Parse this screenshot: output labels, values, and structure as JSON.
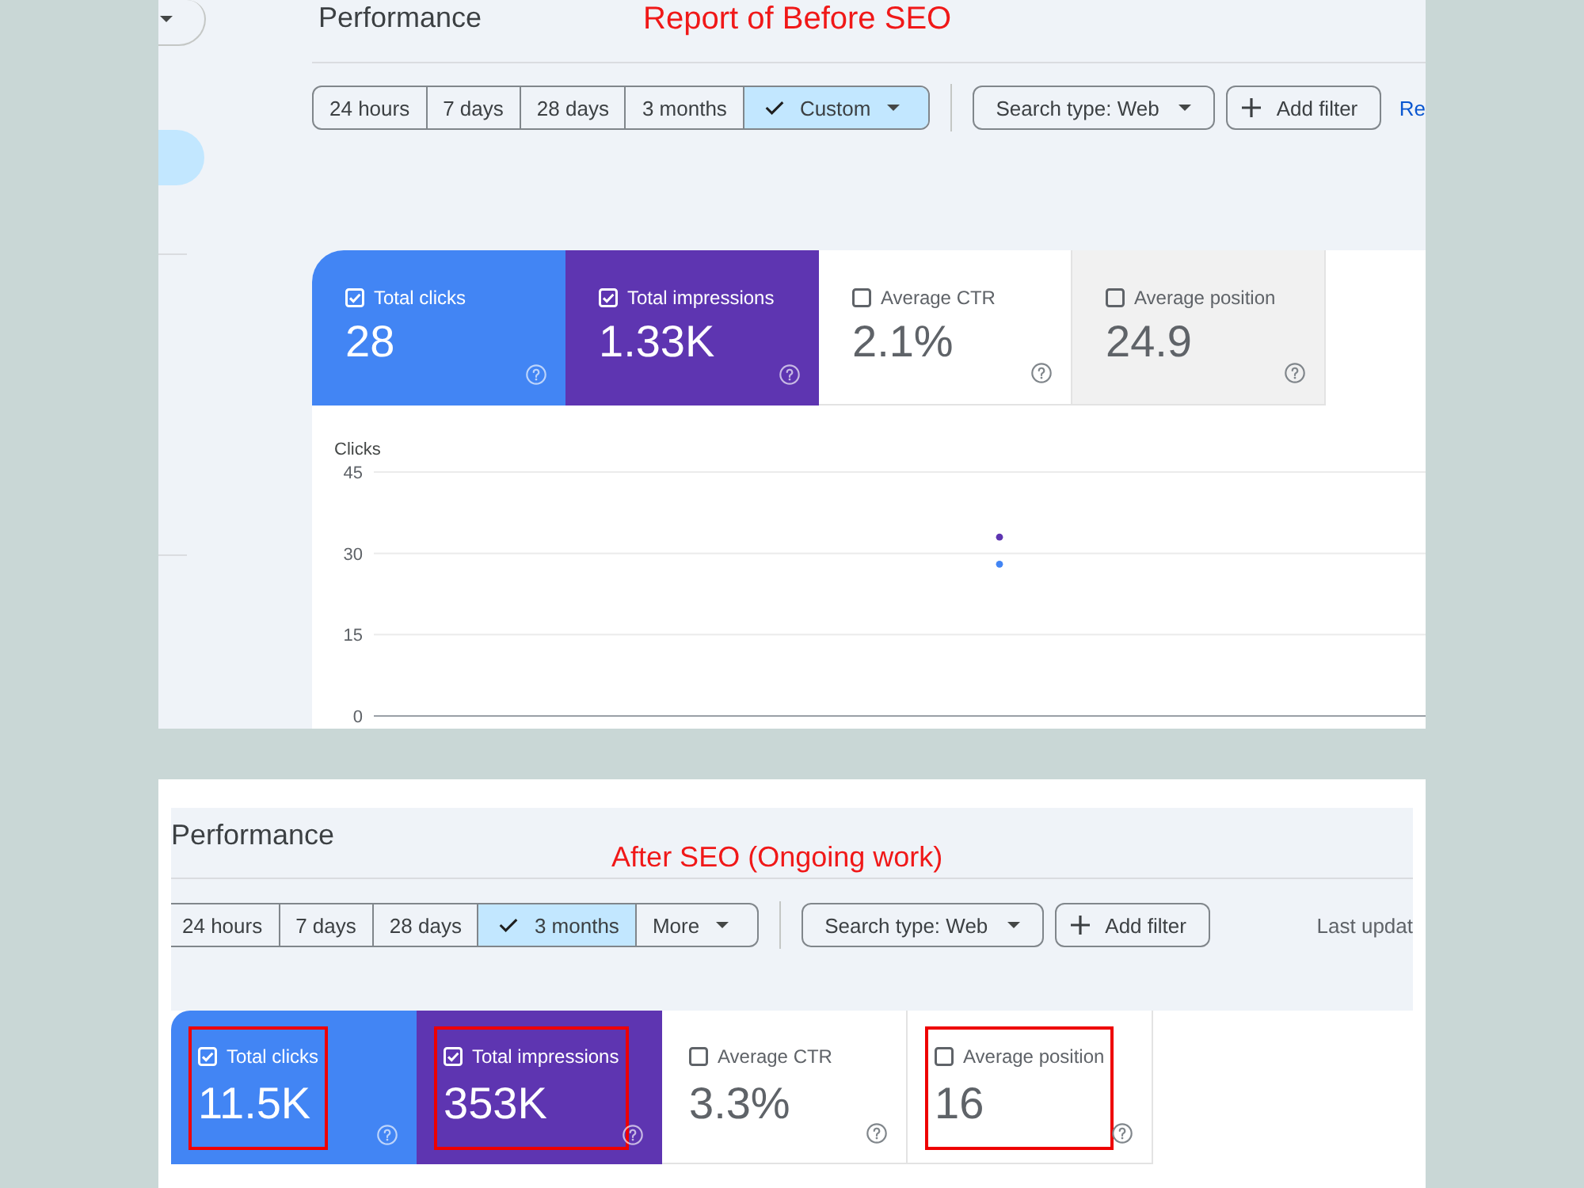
{
  "before": {
    "sidebar": {
      "items": [
        {
          "selected": true
        }
      ]
    },
    "title": "Performance",
    "annotation": "Report of Before SEO",
    "date_ranges": [
      {
        "label": "24 hours",
        "kind": "option",
        "selected": false
      },
      {
        "label": "7 days",
        "kind": "option",
        "selected": false
      },
      {
        "label": "28 days",
        "kind": "option",
        "selected": false
      },
      {
        "label": "3 months",
        "kind": "option",
        "selected": false
      },
      {
        "label": "Custom",
        "kind": "menu",
        "selected": true
      }
    ],
    "filters": [
      {
        "label": "Search type: Web",
        "kind": "dropdown"
      },
      {
        "label": "Add filter",
        "kind": "add"
      }
    ],
    "link": "Re",
    "metrics": [
      {
        "label": "Total clicks",
        "value": "28",
        "checked": true,
        "color": "#4285f4",
        "hovered": false
      },
      {
        "label": "Total impressions",
        "value": "1.33K",
        "checked": true,
        "color": "#5e35b1",
        "hovered": false
      },
      {
        "label": "Average CTR",
        "value": "2.1%",
        "checked": false,
        "hovered": false
      },
      {
        "label": "Average position",
        "value": "24.9",
        "checked": false,
        "hovered": true
      }
    ],
    "chart": {
      "chart_data": {
        "type": "scatter",
        "ylabel": "Clicks",
        "ylim": [
          0,
          45
        ],
        "yticks": [
          0,
          15,
          30,
          45
        ],
        "series": [
          {
            "color": "#4285f4",
            "values": [
              28
            ]
          },
          {
            "color": "#5e35b1",
            "values": [
              33
            ]
          }
        ]
      }
    }
  },
  "after": {
    "title": "Performance",
    "annotation": "After SEO (Ongoing work)",
    "date_ranges": [
      {
        "label": "24 hours",
        "kind": "option",
        "selected": false
      },
      {
        "label": "7 days",
        "kind": "option",
        "selected": false
      },
      {
        "label": "28 days",
        "kind": "option",
        "selected": false
      },
      {
        "label": "3 months",
        "kind": "option",
        "selected": true
      },
      {
        "label": "More",
        "kind": "menu",
        "selected": false
      }
    ],
    "filters": [
      {
        "label": "Search type: Web",
        "kind": "dropdown"
      },
      {
        "label": "Add filter",
        "kind": "add"
      }
    ],
    "last_updated": "Last updat",
    "metrics": [
      {
        "label": "Total clicks",
        "value": "11.5K",
        "checked": true,
        "color": "#4285f4",
        "highlighted": true
      },
      {
        "label": "Total impressions",
        "value": "353K",
        "checked": true,
        "color": "#5e35b1",
        "highlighted": true
      },
      {
        "label": "Average CTR",
        "value": "3.3%",
        "checked": false,
        "highlighted": false
      },
      {
        "label": "Average position",
        "value": "16",
        "checked": false,
        "highlighted": true
      }
    ]
  }
}
